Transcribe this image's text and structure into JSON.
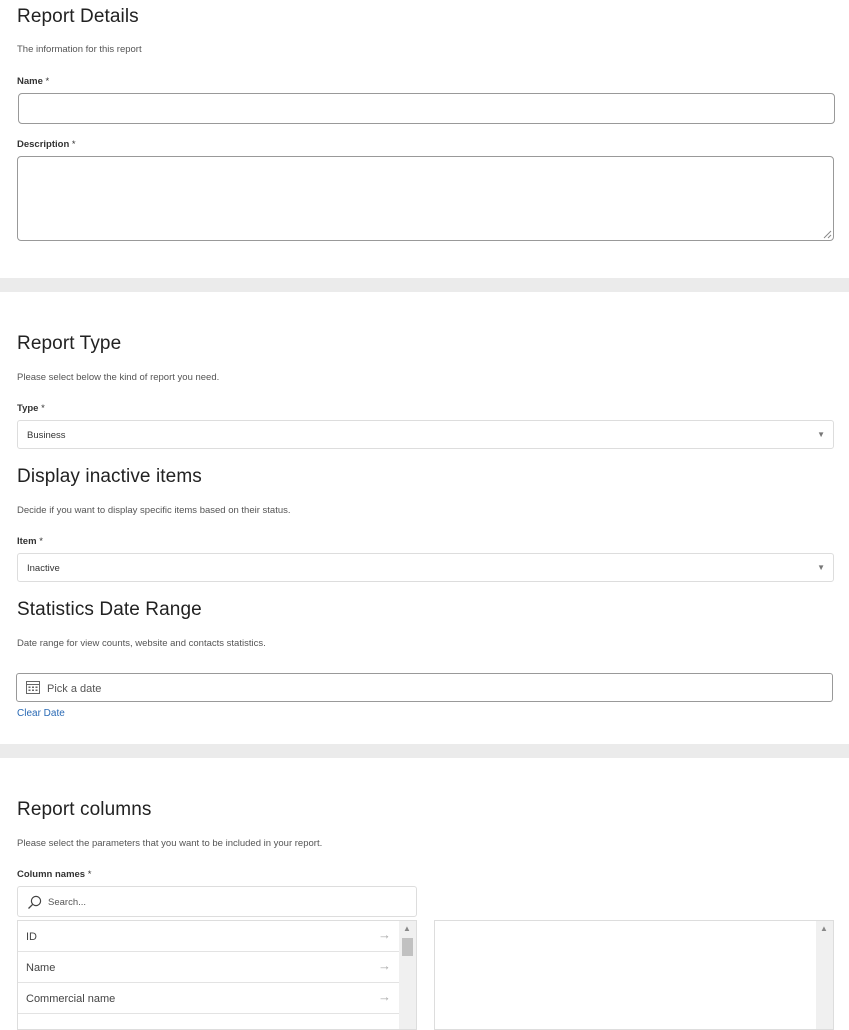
{
  "report_details": {
    "title": "Report Details",
    "subtitle": "The information for this report",
    "name_label": "Name",
    "description_label": "Description",
    "required_mark": "*",
    "name_value": "",
    "description_value": ""
  },
  "report_type": {
    "title": "Report Type",
    "subtitle": "Please select below the kind of report you need.",
    "type_label": "Type",
    "type_value": "Business"
  },
  "inactive_items": {
    "title": "Display inactive items",
    "subtitle": "Decide if you want to display specific items based on their status.",
    "item_label": "Item",
    "item_value": "Inactive"
  },
  "date_range": {
    "title": "Statistics Date Range",
    "subtitle": "Date range for view counts, website and contacts statistics.",
    "placeholder": "Pick a date",
    "clear_label": "Clear Date"
  },
  "report_columns": {
    "title": "Report columns",
    "subtitle": "Please select the parameters that you want to be included in your report.",
    "column_names_label": "Column names",
    "search_placeholder": "Search...",
    "available": [
      {
        "label": "ID"
      },
      {
        "label": "Name"
      },
      {
        "label": "Commercial name"
      }
    ]
  },
  "icons": {
    "dropdown": "triangle-down",
    "calendar": "calendar-icon",
    "search": "magnifier-icon",
    "add": "arrow-right-icon"
  },
  "colors": {
    "separator": "#ebebeb",
    "link": "#2a6ab5"
  }
}
